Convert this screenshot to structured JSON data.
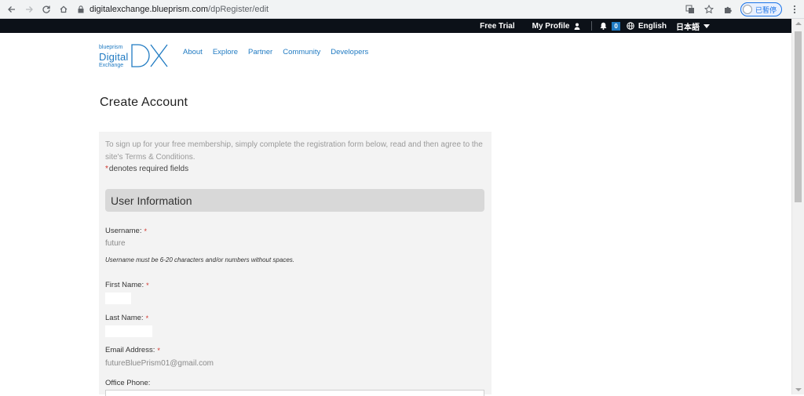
{
  "browser": {
    "url_host": "digitalexchange.blueprism.com",
    "url_path": "/dpRegister/edit",
    "profile_label": "已暫停"
  },
  "topbar": {
    "free_trial": "Free Trial",
    "my_profile": "My Profile",
    "notification_count": "0",
    "language": "English",
    "japanese": "日本語"
  },
  "logo": {
    "small": "blueprism",
    "digital": "Digital",
    "exchange": "Exchange",
    "dx": "DX"
  },
  "site_nav": [
    "About",
    "Explore",
    "Partner",
    "Community",
    "Developers"
  ],
  "page_title": "Create Account",
  "form": {
    "intro": "To sign up for your free membership, simply complete the registration form below, read and then agree to the site's Terms & Conditions.",
    "required_note": "denotes required fields",
    "required_marker": "*",
    "section_title": "User Information",
    "username_label": "Username:",
    "username_value": "future",
    "username_hint": "Username must be 6-20 characters and/or numbers without spaces.",
    "first_name_label": "First Name:",
    "first_name_value": "",
    "last_name_label": "Last Name:",
    "last_name_value": "",
    "email_label": "Email Address:",
    "email_value": "futureBluePrism01@gmail.com",
    "office_phone_label": "Office Phone:"
  },
  "colors": {
    "topbar_bg": "#0c1118",
    "brand_blue": "#1f7ac2",
    "panel_bg": "#f3f3f3",
    "section_bg": "#d8d8d8",
    "required_red": "#d0342c"
  }
}
